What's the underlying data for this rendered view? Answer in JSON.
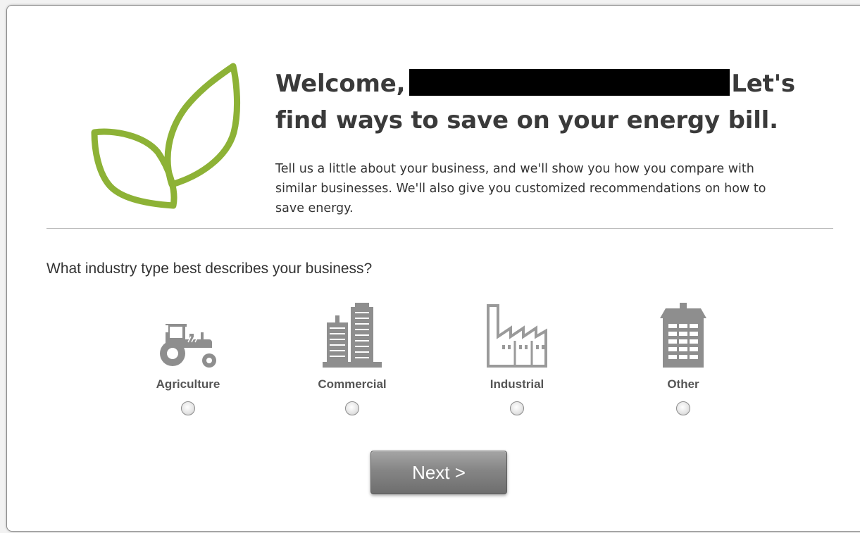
{
  "welcome": {
    "heading_before": "Welcome,",
    "heading_after": "Let's find ways to save on your energy bill.",
    "intro": "Tell us a little about your business, and we'll show you how you compare with similar businesses. We'll also give you customized recommendations on how to save energy."
  },
  "question": "What industry type best describes your business?",
  "industries": [
    {
      "label": "Agriculture",
      "icon": "tractor-icon"
    },
    {
      "label": "Commercial",
      "icon": "office-buildings-icon"
    },
    {
      "label": "Industrial",
      "icon": "factory-icon"
    },
    {
      "label": "Other",
      "icon": "building-icon"
    }
  ],
  "next_label": "Next >",
  "colors": {
    "leaf": "#8db236",
    "icon_gray": "#8e8e8e",
    "button": "#7f7f7f"
  }
}
